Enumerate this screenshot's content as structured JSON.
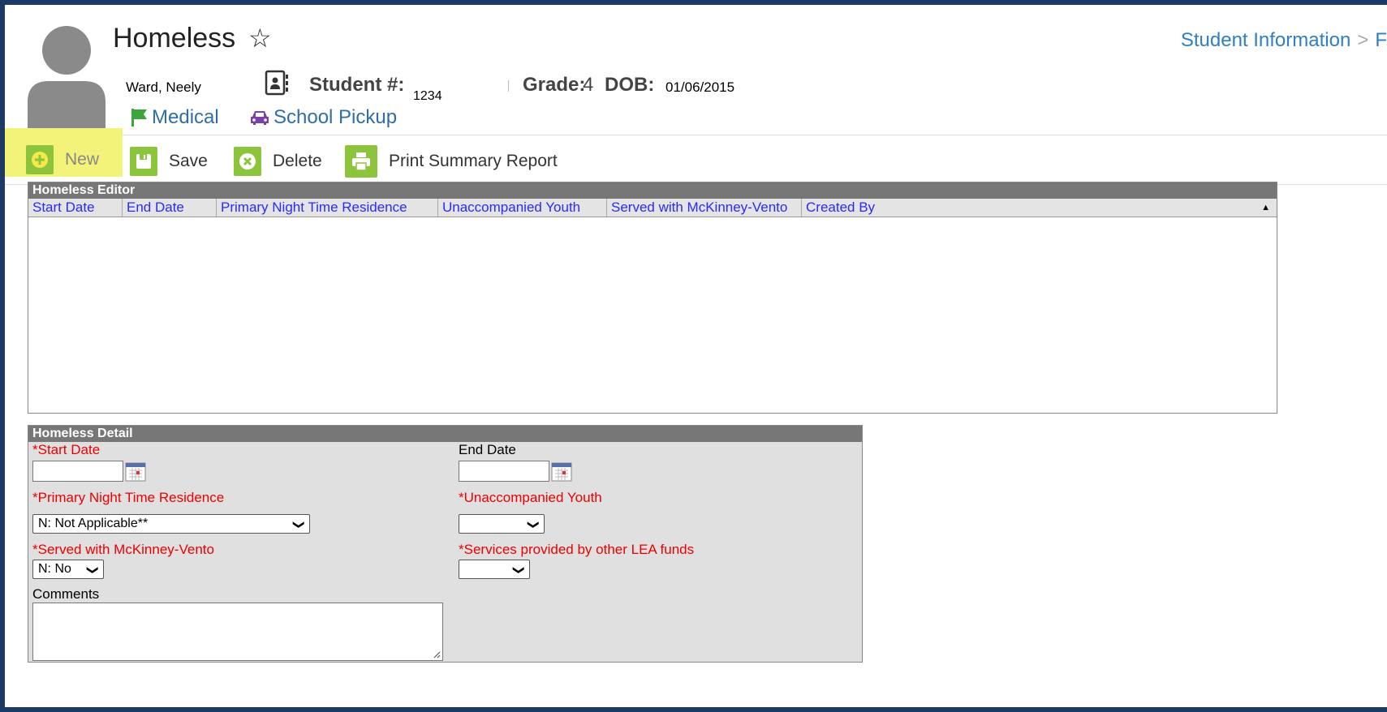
{
  "header": {
    "title": "Homeless",
    "breadcrumb": [
      "Student Information",
      "F"
    ],
    "student_name": "Ward, Neely",
    "student_num_label": "Student #:",
    "student_num_value": "1234",
    "grade_label": "Grade:",
    "grade_value": "4",
    "dob_label": "DOB:",
    "dob_value": "01/06/2015",
    "flags": [
      {
        "label": "Medical",
        "icon": "flag-icon",
        "color": "#3ca63c"
      },
      {
        "label": "School Pickup",
        "icon": "car-icon",
        "color": "#7b3fa8"
      }
    ]
  },
  "toolbar": {
    "new_label": "New",
    "save_label": "Save",
    "delete_label": "Delete",
    "print_label": "Print Summary Report",
    "accent": "#8cc43c",
    "highlight": "#f3f37a"
  },
  "editor": {
    "title": "Homeless Editor",
    "columns": [
      "Start Date",
      "End Date",
      "Primary Night Time Residence",
      "Unaccompanied Youth",
      "Served with McKinney-Vento",
      "Created By"
    ],
    "rows": []
  },
  "detail": {
    "title": "Homeless Detail",
    "start_date_label": "*Start Date",
    "start_date_value": "",
    "end_date_label": "End Date",
    "end_date_value": "",
    "residence_label": "*Primary Night Time Residence",
    "residence_value": "N: Not Applicable**",
    "youth_label": "*Unaccompanied Youth",
    "youth_value": "",
    "mckinney_label": "*Served with McKinney-Vento",
    "mckinney_value": "N: No",
    "lea_label": "*Services provided by other LEA funds",
    "lea_value": "",
    "comments_label": "Comments",
    "comments_value": ""
  }
}
